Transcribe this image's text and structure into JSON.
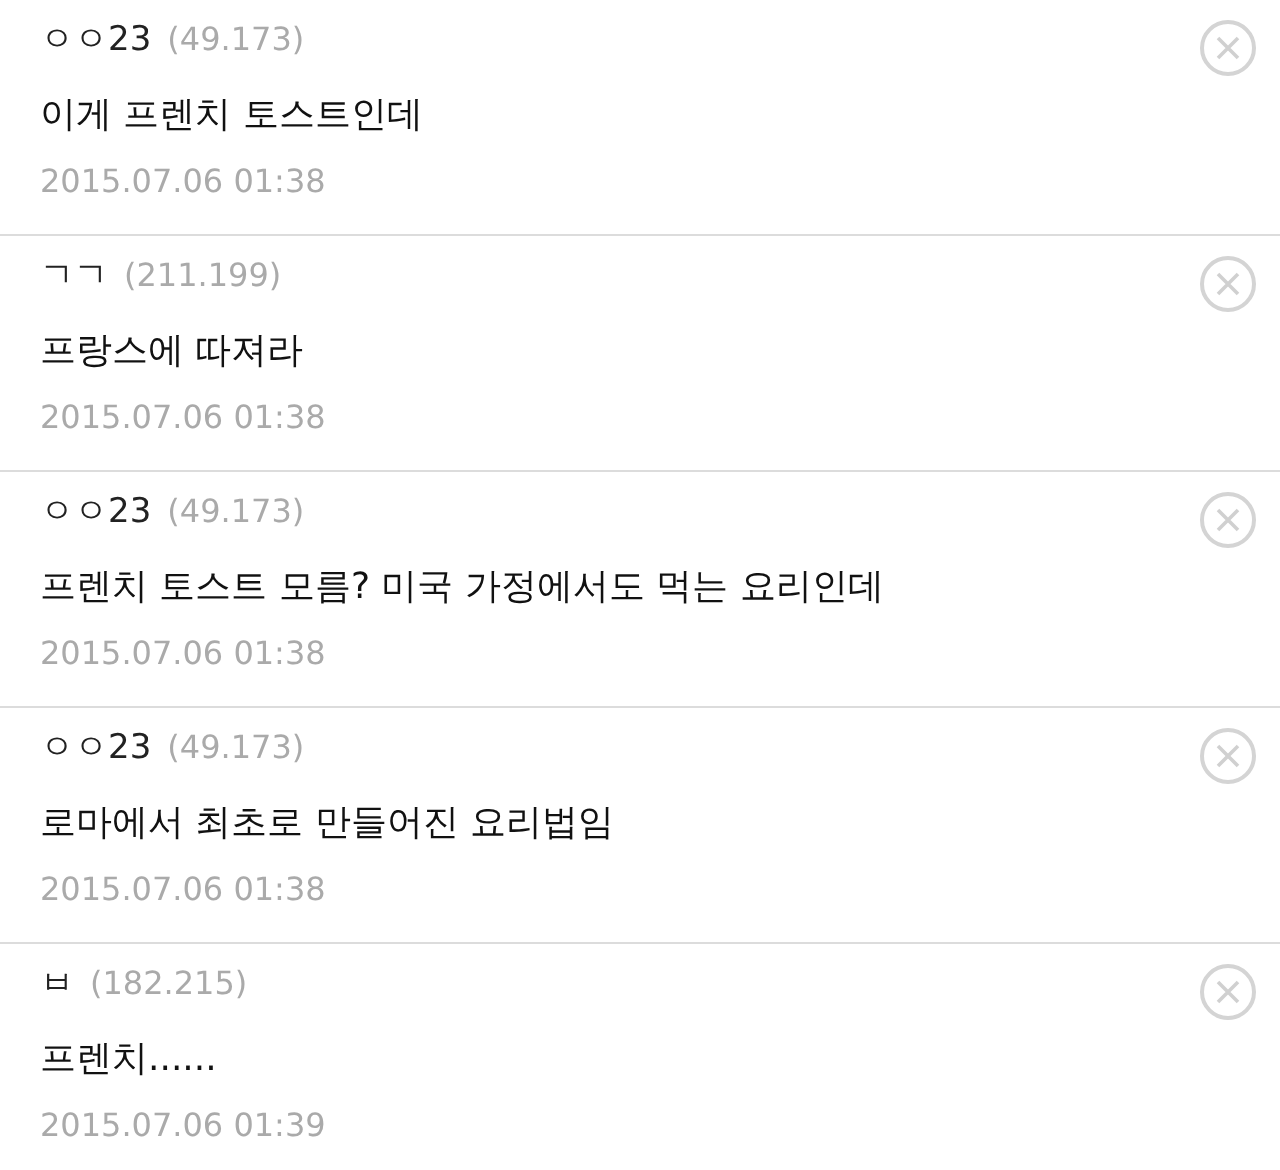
{
  "comments": [
    {
      "author": "ㅇㅇ23",
      "ip": "(49.173)",
      "text": "이게 프렌치 토스트인데",
      "date": "2015.07.06 01:38"
    },
    {
      "author": "ㄱㄱ",
      "ip": "(211.199)",
      "text": "프랑스에 따져라",
      "date": "2015.07.06 01:38"
    },
    {
      "author": "ㅇㅇ23",
      "ip": "(49.173)",
      "text": "프렌치 토스트 모름? 미국 가정에서도 먹는 요리인데",
      "date": "2015.07.06 01:38"
    },
    {
      "author": "ㅇㅇ23",
      "ip": "(49.173)",
      "text": "로마에서 최초로 만들어진 요리법임",
      "date": "2015.07.06 01:38"
    },
    {
      "author": "ㅂ",
      "ip": "(182.215)",
      "text": "프렌치......",
      "date": "2015.07.06 01:39"
    }
  ]
}
